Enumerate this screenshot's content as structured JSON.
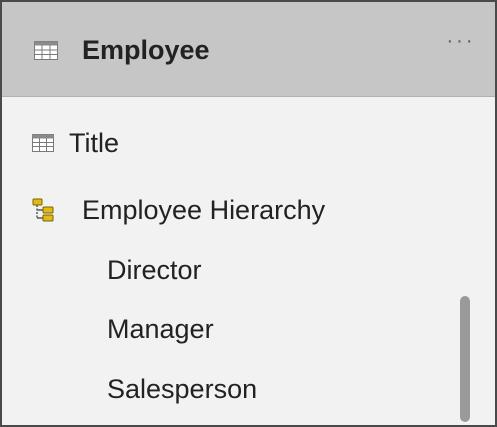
{
  "table": {
    "title": "Employee",
    "icon": "table-icon",
    "more_label": "···"
  },
  "fields": [
    {
      "label": "Title",
      "icon": "table-field-icon",
      "level": 0
    },
    {
      "label": "Employee Hierarchy",
      "icon": "hierarchy-icon",
      "level": 0
    },
    {
      "label": "Director",
      "level": 1
    },
    {
      "label": "Manager",
      "level": 1
    },
    {
      "label": "Salesperson",
      "level": 1
    }
  ],
  "colors": {
    "header_bg": "#c6c6c6",
    "panel_bg": "#f2f2f2",
    "text": "#222222",
    "hierarchy_icon": "#d8b000",
    "scrollbar_thumb": "#9a9a9a"
  }
}
